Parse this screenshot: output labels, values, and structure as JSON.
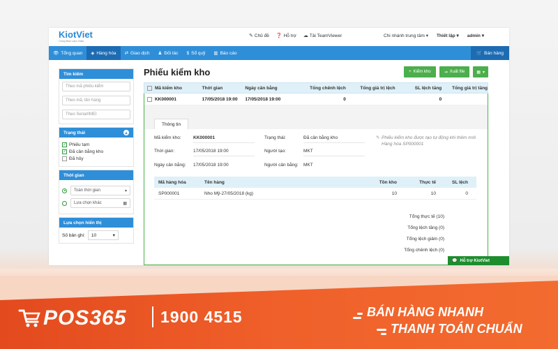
{
  "header": {
    "logo": "KiotViet",
    "logo_tagline": "Cùng Bạn Làm Giàu",
    "links": {
      "theme": "Chủ đề",
      "help": "Hỗ trợ",
      "teamviewer": "Tải TeamViewer"
    },
    "branch": "Chi nhánh trung tâm",
    "settings": "Thiết lập",
    "user": "admin"
  },
  "nav": {
    "items": [
      "Tổng quan",
      "Hàng hóa",
      "Giao dịch",
      "Đối tác",
      "Sổ quỹ",
      "Báo cáo"
    ],
    "sell": "Bán hàng"
  },
  "sidebar": {
    "search": {
      "title": "Tìm kiếm",
      "placeholders": [
        "Theo mã phiếu kiểm",
        "Theo mã, tên hàng",
        "Theo Serial/IMEI"
      ]
    },
    "status": {
      "title": "Trạng thái",
      "options": [
        "Phiếu tạm",
        "Đã cân bằng kho",
        "Đã hủy"
      ]
    },
    "time": {
      "title": "Thời gian",
      "option1": "Toàn thời gian",
      "option2": "Lựa chọn khác"
    },
    "display": {
      "title": "Lựa chọn hiển thị",
      "label": "Số bản ghi:",
      "value": "10"
    }
  },
  "page": {
    "title": "Phiếu kiểm kho",
    "buttons": {
      "add": "Kiểm kho",
      "export": "Xuất file"
    }
  },
  "table": {
    "headers": [
      "Mã kiểm kho",
      "Thời gian",
      "Ngày cân bằng",
      "Tổng chênh lệch",
      "Tổng giá trị lệch",
      "SL lệch tăng",
      "Tổng giá trị tăng"
    ],
    "row": [
      "KK000001",
      "17/05/2018 19:00",
      "17/05/2018 19:00",
      "0",
      "",
      "0",
      ""
    ]
  },
  "detail": {
    "tab": "Thông tin",
    "labels": {
      "code": "Mã kiểm kho:",
      "time": "Thời gian:",
      "balance_date": "Ngày cân bằng:",
      "status": "Trạng thái:",
      "creator": "Người tạo:",
      "balancer": "Người cân bằng:"
    },
    "values": {
      "code": "KK000001",
      "time": "17/05/2018 19:00",
      "balance_date": "17/05/2018 19:00",
      "status": "Đã cân bằng kho",
      "creator": "MKT",
      "balancer": "MKT"
    },
    "note": "Phiếu kiểm kho được tạo tự động khi thêm mới Hàng hóa SP000001",
    "items_headers": [
      "Mã hàng hóa",
      "Tên hàng",
      "Tồn kho",
      "Thực tế",
      "SL lệch"
    ],
    "items": [
      [
        "SP000001",
        "Nho Mỹ-27/05/2018 (kg)",
        "10",
        "10",
        "0"
      ]
    ],
    "totals": [
      "Tổng thực tế (10)",
      "Tổng lệch tăng (0)",
      "Tổng lệch giảm (0)",
      "Tổng chênh lệch (0)"
    ]
  },
  "support": "Hỗ trợ KiotViet",
  "banner": {
    "brand": "POS365",
    "phone": "1900 4515",
    "slogan1": "BÁN HÀNG NHANH",
    "slogan2": "THANH TOÁN CHUẨN"
  }
}
